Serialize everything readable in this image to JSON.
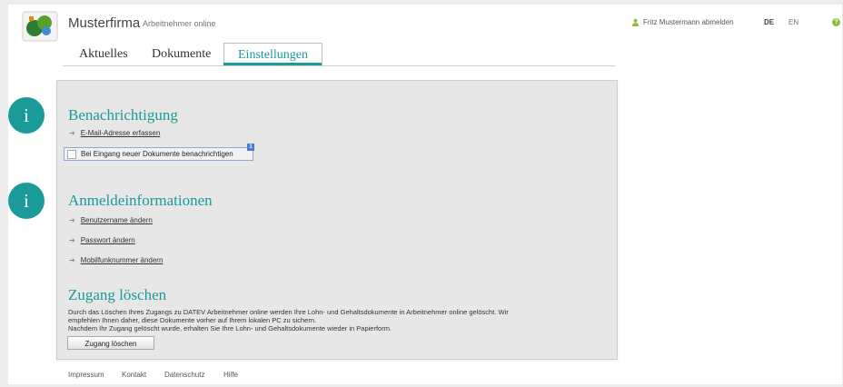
{
  "header": {
    "company": "Musterfirma",
    "product": "Arbeitnehmer online",
    "user_link": "Fritz Mustermann abmelden",
    "lang_de": "DE",
    "lang_en": "EN",
    "help_glyph": "?"
  },
  "tabs": [
    "Aktuelles",
    "Dokumente",
    "Einstellungen"
  ],
  "active_tab": "Einstellungen",
  "info_icon_glyph": "i",
  "sections": {
    "benachrichtigung": {
      "title": "Benachrichtigung",
      "link_email": "E-Mail-Adresse erfassen",
      "checkbox_label": "Bei Eingang neuer Dokumente benachrichtigen",
      "checkbox_checked": false,
      "badge": "1"
    },
    "anmeldeinformationen": {
      "title": "Anmeldeinformationen",
      "links": [
        "Benutzername ändern",
        "Passwort ändern",
        "Mobilfunknummer ändern"
      ]
    },
    "zugang": {
      "title": "Zugang löschen",
      "desc_line1": "Durch das Löschen Ihres Zugangs zu DATEV Arbeitnehmer online werden Ihre Lohn- und Gehaltsdokumente in Arbeitnehmer online gelöscht. Wir",
      "desc_line2": "empfehlen Ihnen daher, diese Dokumente vorher auf Ihrem lokalen PC zu sichern.",
      "desc_line3": "Nachdem Ihr Zugang gelöscht wurde, erhalten Sie Ihre Lohn- und Gehaltsdokumente wieder in Papierform.",
      "button": "Zugang löschen"
    }
  },
  "footer": [
    "Impressum",
    "Kontakt",
    "Datenschutz",
    "Hilfe"
  ],
  "colors": {
    "accent": "#1a9a99",
    "panel": "#e7e7e7",
    "user_icon": "#8bbf3f"
  }
}
